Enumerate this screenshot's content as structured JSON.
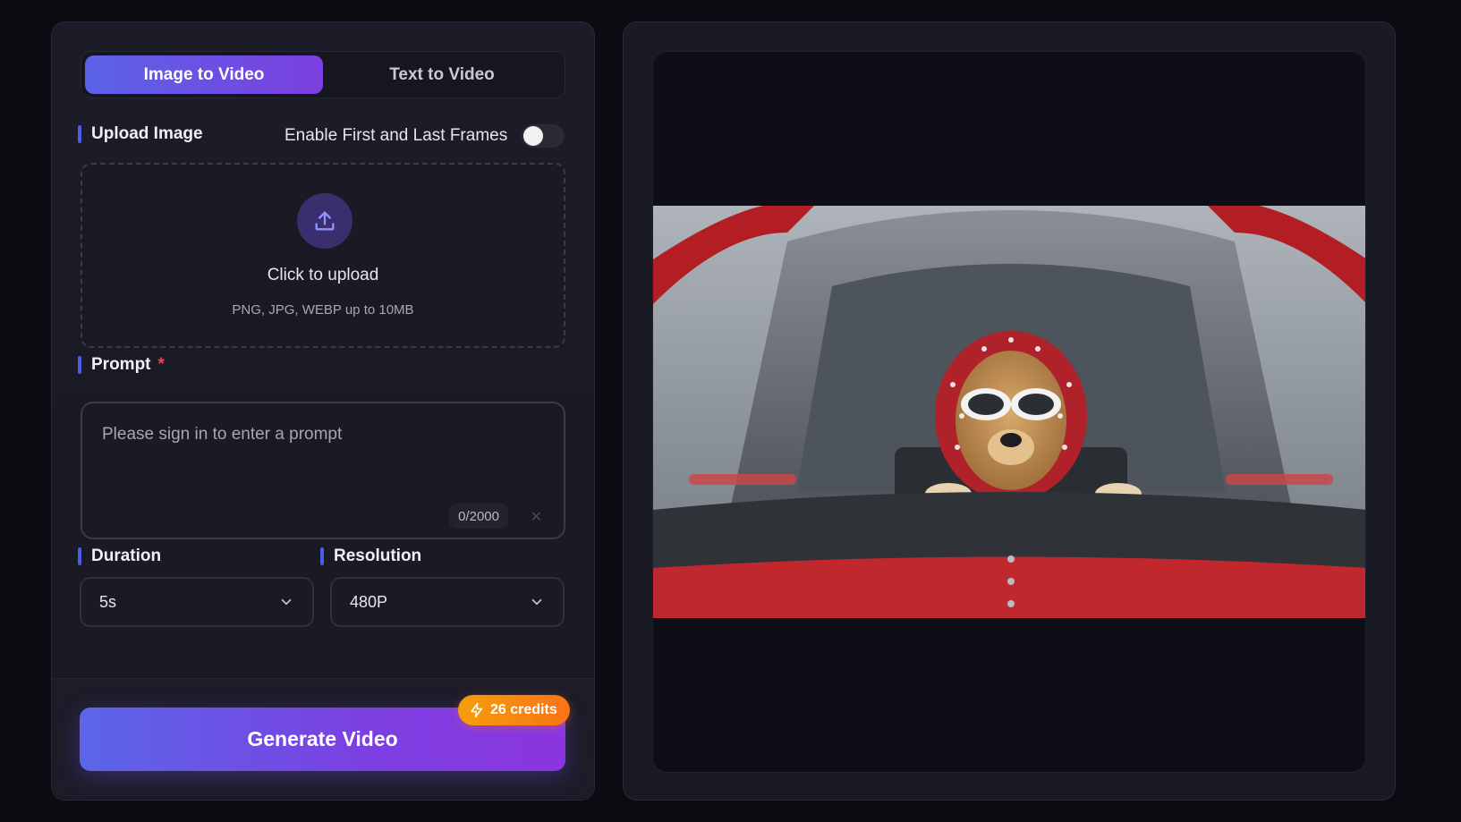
{
  "tabs": [
    {
      "label": "Image to Video",
      "active": true
    },
    {
      "label": "Text to Video",
      "active": false
    }
  ],
  "upload": {
    "section_label": "Upload Image",
    "toggle_label": "Enable First and Last Frames",
    "toggle_on": false,
    "title": "Click to upload",
    "hint": "PNG, JPG, WEBP up to 10MB",
    "icon": "upload-icon"
  },
  "prompt": {
    "section_label": "Prompt",
    "required_mark": "*",
    "placeholder": "Please sign in to enter a prompt",
    "value": "",
    "char_count": "0/2000",
    "clear_icon": "close-icon"
  },
  "duration": {
    "section_label": "Duration",
    "selected": "5s"
  },
  "resolution": {
    "section_label": "Resolution",
    "selected": "480P"
  },
  "generate": {
    "label": "Generate Video",
    "credits_label": "26 credits",
    "credits_icon": "lightning-icon"
  },
  "preview": {
    "subject": "dog in goggles and red heart-print headscarf in red airplane cockpit"
  },
  "colors": {
    "accent_start": "#5b63e6",
    "accent_end": "#7b3fe0",
    "badge": "#f59e0b",
    "required": "#ef4444"
  }
}
